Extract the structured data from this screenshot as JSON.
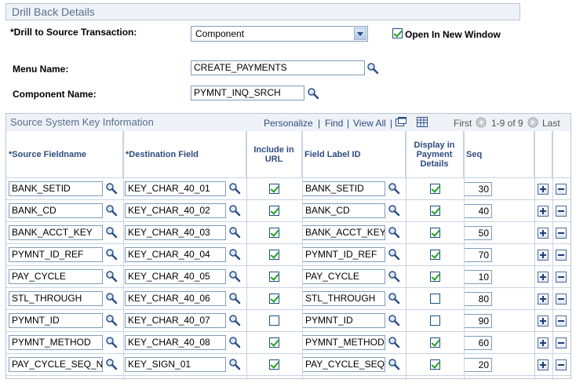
{
  "section": {
    "title": "Drill Back Details"
  },
  "drill": {
    "label": "*Drill to Source Transaction:",
    "value": "Component",
    "open_new_window_label": "Open In New Window",
    "open_new_window": true
  },
  "menu": {
    "label": "Menu Name:",
    "value": "CREATE_PAYMENTS"
  },
  "component": {
    "label": "Component Name:",
    "value": "PYMNT_INQ_SRCH"
  },
  "grid": {
    "title": "Source System Key Information",
    "nav": {
      "personalize": "Personalize",
      "find": "Find",
      "view_all": "View All",
      "first": "First",
      "range": "1-9 of 9",
      "last": "Last"
    },
    "headers": {
      "source": "*Source Fieldname",
      "destination": "*Destination Field",
      "include_url": "Include in URL",
      "field_label": "Field Label ID",
      "display_payment": "Display in Payment Details",
      "seq": "Seq"
    },
    "rows": [
      {
        "source": "BANK_SETID",
        "dest": "KEY_CHAR_40_01",
        "include": true,
        "label": "BANK_SETID",
        "display": true,
        "seq": "30"
      },
      {
        "source": "BANK_CD",
        "dest": "KEY_CHAR_40_02",
        "include": true,
        "label": "BANK_CD",
        "display": true,
        "seq": "40"
      },
      {
        "source": "BANK_ACCT_KEY",
        "dest": "KEY_CHAR_40_03",
        "include": true,
        "label": "BANK_ACCT_KEY",
        "display": true,
        "seq": "50"
      },
      {
        "source": "PYMNT_ID_REF",
        "dest": "KEY_CHAR_40_04",
        "include": true,
        "label": "PYMNT_ID_REF",
        "display": true,
        "seq": "70"
      },
      {
        "source": "PAY_CYCLE",
        "dest": "KEY_CHAR_40_05",
        "include": true,
        "label": "PAY_CYCLE",
        "display": true,
        "seq": "10"
      },
      {
        "source": "STL_THROUGH",
        "dest": "KEY_CHAR_40_06",
        "include": true,
        "label": "STL_THROUGH",
        "display": false,
        "seq": "80"
      },
      {
        "source": "PYMNT_ID",
        "dest": "KEY_CHAR_40_07",
        "include": false,
        "label": "PYMNT_ID",
        "display": false,
        "seq": "90"
      },
      {
        "source": "PYMNT_METHOD",
        "dest": "KEY_CHAR_40_08",
        "include": true,
        "label": "PYMNT_METHOD",
        "display": true,
        "seq": "60"
      },
      {
        "source": "PAY_CYCLE_SEQ_N",
        "dest": "KEY_SIGN_01",
        "include": true,
        "label": "PAY_CYCLE_SEQ",
        "display": true,
        "seq": "20"
      }
    ]
  },
  "icons": {
    "lookup": "magnifier-icon",
    "add_row": "plus-icon",
    "delete_row": "minus-icon"
  },
  "colors": {
    "header_text": "#5b6f8e",
    "link": "#2f4b80",
    "check": "#21a121",
    "border": "#7f9db9"
  }
}
